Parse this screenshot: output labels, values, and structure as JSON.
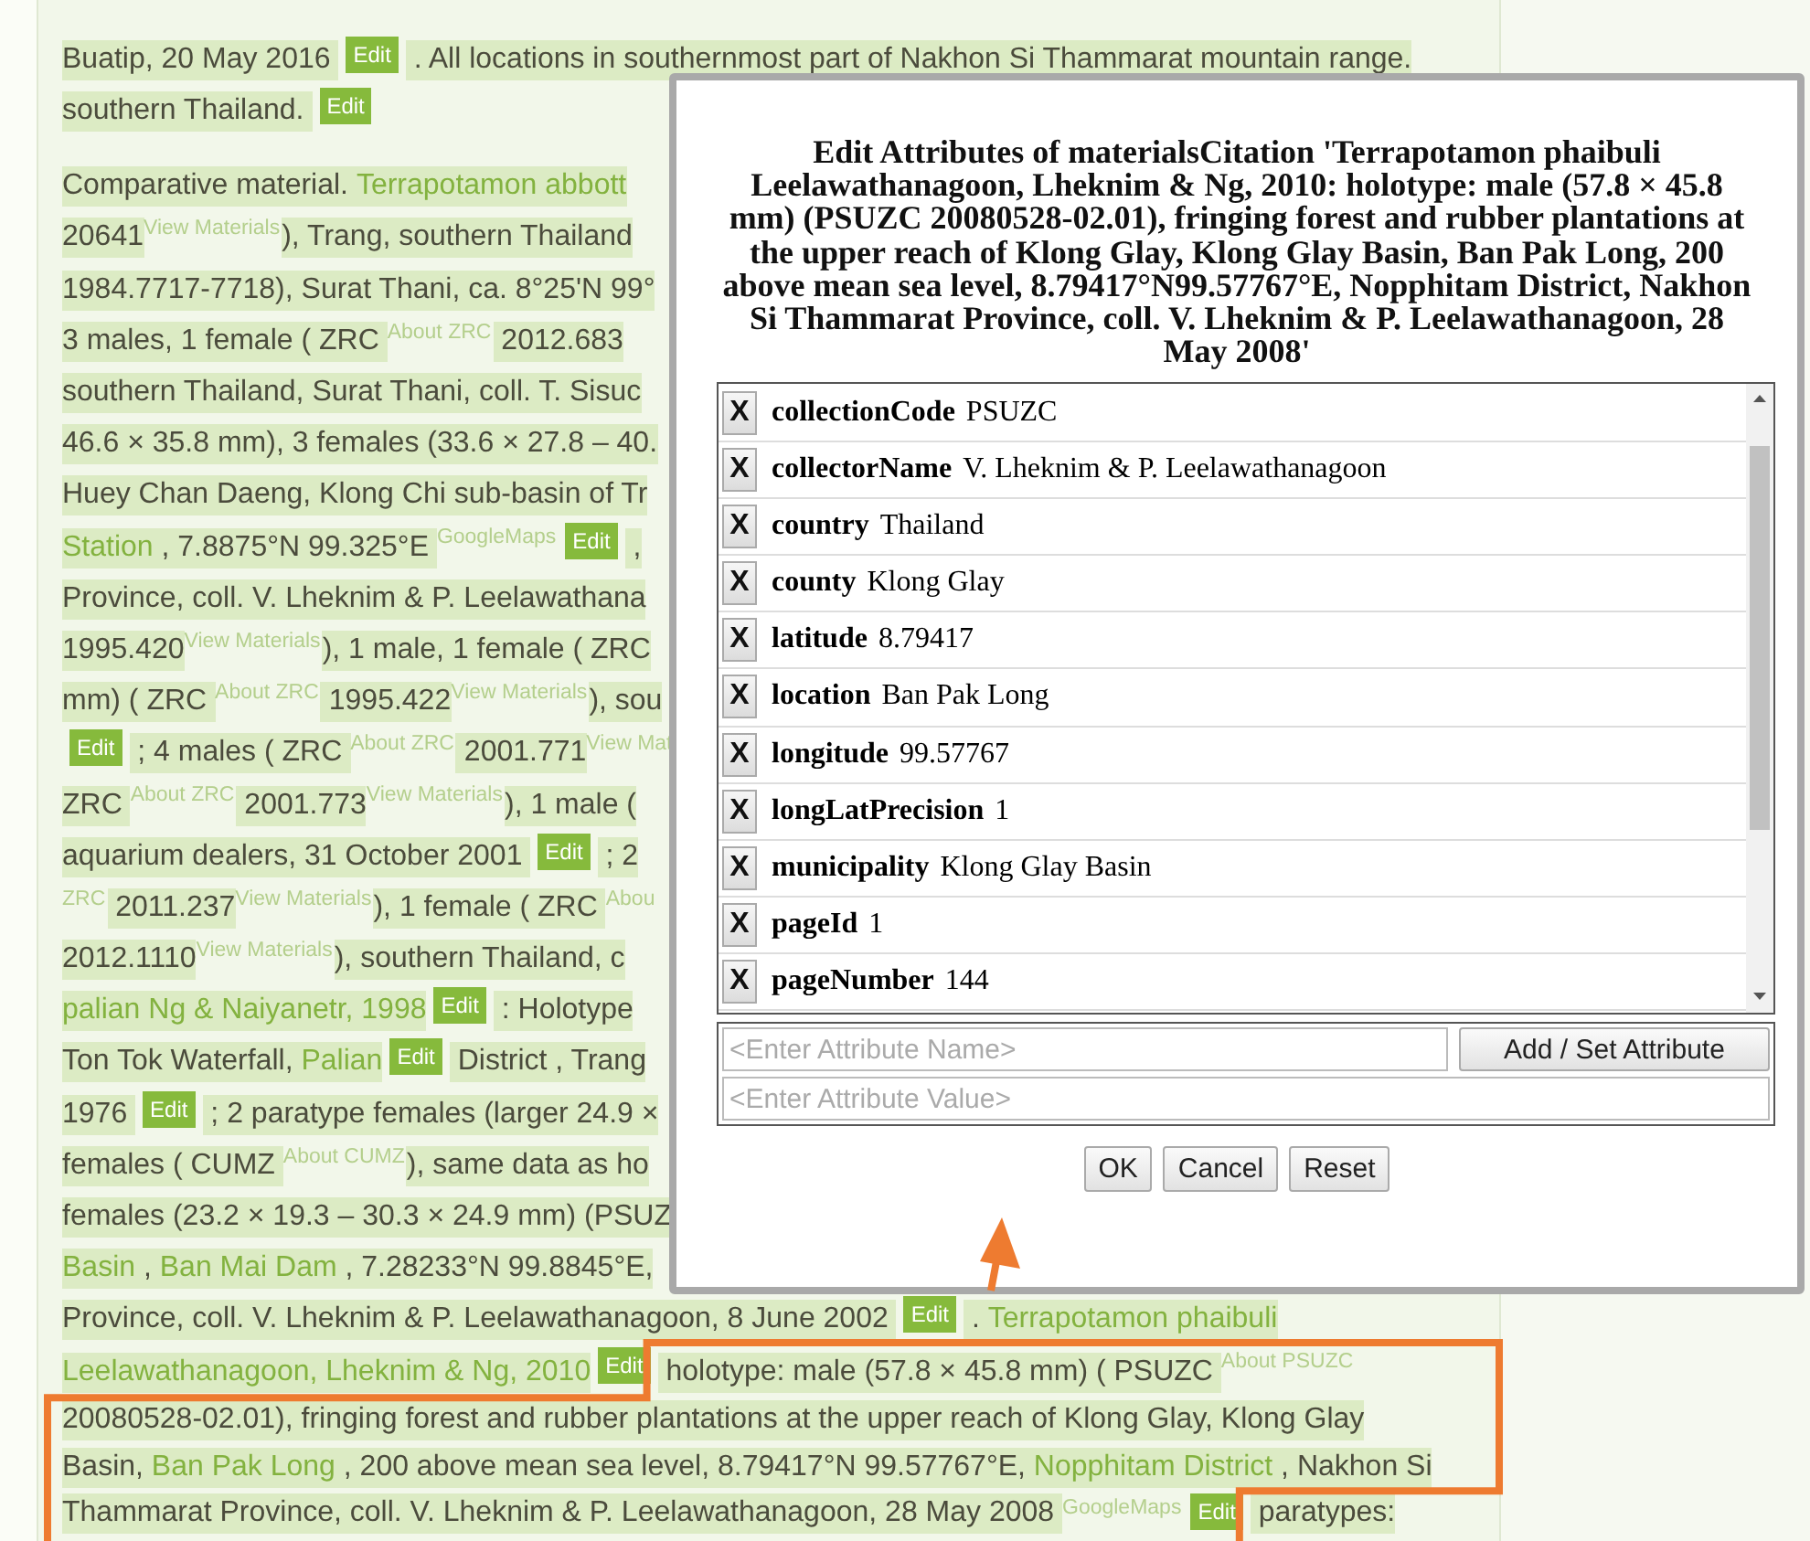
{
  "article": {
    "paragraphs": [
      {
        "lines": [
          {
            "segments": [
              {
                "kind": "text",
                "text": "Buatip, 20 May 2016 "
              },
              {
                "kind": "edit",
                "text": "Edit"
              },
              {
                "kind": "text",
                "text": " . All locations in southernmost part of Nakhon Si Thammarat mountain range."
              }
            ]
          },
          {
            "segments": [
              {
                "kind": "text",
                "text": "southern Thailand. "
              },
              {
                "kind": "edit",
                "text": "Edit"
              }
            ]
          }
        ]
      },
      {
        "lines": [
          {
            "segments": [
              {
                "kind": "text",
                "text": "Comparative material. "
              },
              {
                "kind": "link",
                "text": "Terrapotamon abbott"
              }
            ]
          },
          {
            "segments": [
              {
                "kind": "text",
                "text": "20641"
              },
              {
                "kind": "sup",
                "text": "View Materials"
              },
              {
                "kind": "text",
                "text": "), Trang, southern Thailand"
              }
            ]
          },
          {
            "segments": [
              {
                "kind": "text",
                "text": "1984.7717-7718), Surat Thani, ca. 8°25'N 99°"
              }
            ]
          },
          {
            "segments": [
              {
                "kind": "text",
                "text": "3 males, 1 female ( ZRC "
              },
              {
                "kind": "sup",
                "text": "About ZRC"
              },
              {
                "kind": "text",
                "text": " 2012.683"
              }
            ]
          },
          {
            "segments": [
              {
                "kind": "text",
                "text": "southern Thailand, Surat Thani, coll. T. Sisuc"
              }
            ]
          },
          {
            "segments": [
              {
                "kind": "text",
                "text": "46.6 × 35.8 mm), 3 females (33.6 × 27.8 – 40."
              }
            ]
          },
          {
            "segments": [
              {
                "kind": "text",
                "text": "Huey Chan Daeng, Klong Chi sub-basin of Tr"
              }
            ]
          },
          {
            "segments": [
              {
                "kind": "link",
                "text": "Station"
              },
              {
                "kind": "text",
                "text": " , 7.8875°N 99.325°E "
              },
              {
                "kind": "sup",
                "text": "GoogleMaps"
              },
              {
                "kind": "edit",
                "text": "Edit"
              },
              {
                "kind": "text",
                "text": " ,"
              }
            ]
          },
          {
            "segments": [
              {
                "kind": "text",
                "text": "Province, coll. V. Lheknim & P. Leelawathana"
              }
            ]
          },
          {
            "segments": [
              {
                "kind": "text",
                "text": "1995.420"
              },
              {
                "kind": "sup",
                "text": "View Materials"
              },
              {
                "kind": "text",
                "text": "), 1 male, 1 female ( ZRC"
              }
            ]
          },
          {
            "segments": [
              {
                "kind": "text",
                "text": "mm) ( ZRC "
              },
              {
                "kind": "sup",
                "text": "About ZRC"
              },
              {
                "kind": "text",
                "text": " 1995.422"
              },
              {
                "kind": "sup",
                "text": "View Materials"
              },
              {
                "kind": "text",
                "text": "), sou"
              }
            ]
          },
          {
            "segments": [
              {
                "kind": "edit",
                "text": "Edit"
              },
              {
                "kind": "text",
                "text": " ; 4 males ( ZRC "
              },
              {
                "kind": "sup",
                "text": "About ZRC"
              },
              {
                "kind": "text",
                "text": " 2001.771"
              },
              {
                "kind": "sup",
                "text": "View Mat"
              }
            ]
          },
          {
            "segments": [
              {
                "kind": "text",
                "text": "ZRC "
              },
              {
                "kind": "sup",
                "text": "About ZRC"
              },
              {
                "kind": "text",
                "text": " 2001.773"
              },
              {
                "kind": "sup",
                "text": "View Materials"
              },
              {
                "kind": "text",
                "text": "), 1 male ("
              }
            ]
          },
          {
            "segments": [
              {
                "kind": "text",
                "text": "aquarium dealers, 31 October 2001 "
              },
              {
                "kind": "edit",
                "text": "Edit"
              },
              {
                "kind": "text",
                "text": " ; 2"
              }
            ]
          },
          {
            "segments": [
              {
                "kind": "sup",
                "text": "ZRC"
              },
              {
                "kind": "text",
                "text": " 2011.237"
              },
              {
                "kind": "sup",
                "text": "View Materials"
              },
              {
                "kind": "text",
                "text": "), 1 female ( ZRC "
              },
              {
                "kind": "sup",
                "text": "Abou"
              }
            ]
          },
          {
            "segments": [
              {
                "kind": "text",
                "text": "2012.1110"
              },
              {
                "kind": "sup",
                "text": "View Materials"
              },
              {
                "kind": "text",
                "text": "), southern Thailand, c"
              }
            ]
          },
          {
            "segments": [
              {
                "kind": "link",
                "text": "palian Ng & Naiyanetr, 1998"
              },
              {
                "kind": "edit",
                "text": "Edit"
              },
              {
                "kind": "text",
                "text": " : Holotype"
              }
            ]
          },
          {
            "segments": [
              {
                "kind": "text",
                "text": "Ton Tok Waterfall, "
              },
              {
                "kind": "link",
                "text": "Palian"
              },
              {
                "kind": "edit",
                "text": "Edit"
              },
              {
                "kind": "text",
                "text": " District , Trang"
              }
            ]
          },
          {
            "segments": [
              {
                "kind": "text",
                "text": "1976 "
              },
              {
                "kind": "edit",
                "text": "Edit"
              },
              {
                "kind": "text",
                "text": " ; 2 paratype females (larger 24.9 ×"
              }
            ]
          },
          {
            "segments": [
              {
                "kind": "text",
                "text": "females ( CUMZ "
              },
              {
                "kind": "sup",
                "text": "About CUMZ"
              },
              {
                "kind": "text",
                "text": "), same data as ho"
              }
            ]
          },
          {
            "segments": [
              {
                "kind": "text",
                "text": "females (23.2 × 19.3 – 30.3 × 24.9 mm) (PSUZ"
              }
            ]
          },
          {
            "segments": [
              {
                "kind": "link",
                "text": "Basin"
              },
              {
                "kind": "text",
                "text": " , "
              },
              {
                "kind": "link",
                "text": "Ban Mai Dam"
              },
              {
                "kind": "text",
                "text": " , 7.28233°N 99.8845°E,"
              }
            ]
          },
          {
            "segments": [
              {
                "kind": "text",
                "text": "Province, coll. V. Lheknim & P. Leelawathanagoon, 8 June 2002 "
              },
              {
                "kind": "edit",
                "text": "Edit"
              },
              {
                "kind": "text",
                "text": " . "
              },
              {
                "kind": "link",
                "text": "Terrapotamon phaibuli"
              }
            ]
          },
          {
            "segments": [
              {
                "kind": "link",
                "text": "Leelawathanagoon, Lheknim & Ng, 2010"
              },
              {
                "kind": "edit",
                "text": "Edit"
              },
              {
                "kind": "text",
                "text": " holotype: male (57.8 × 45.8 mm) ( PSUZC "
              },
              {
                "kind": "sup",
                "text": "About PSUZC"
              }
            ]
          },
          {
            "segments": [
              {
                "kind": "text",
                "text": "20080528-02.01), fringing forest and rubber plantations at the upper reach of Klong Glay, Klong Glay"
              }
            ]
          },
          {
            "segments": [
              {
                "kind": "text",
                "text": "Basin, "
              },
              {
                "kind": "link",
                "text": "Ban Pak Long"
              },
              {
                "kind": "text",
                "text": " , 200 above mean sea level, 8.79417°N 99.57767°E, "
              },
              {
                "kind": "link",
                "text": "Nopphitam District"
              },
              {
                "kind": "text",
                "text": " , Nakhon Si"
              }
            ]
          },
          {
            "segments": [
              {
                "kind": "text",
                "text": "Thammarat Province, coll. V. Lheknim & P. Leelawathanagoon, 28 May 2008 "
              },
              {
                "kind": "sup",
                "text": "GoogleMaps"
              },
              {
                "kind": "edit",
                "text": "Edit"
              },
              {
                "kind": "text",
                "text": " paratypes:"
              }
            ]
          }
        ]
      }
    ]
  },
  "dialog": {
    "title": "Edit Attributes of materialsCitation 'Terrapotamon phaibuli Leelawathanagoon, Lheknim & Ng, 2010: holotype: male (57.8 × 45.8 mm) (PSUZC 20080528-02.01), fringing forest and rubber plantations at the upper reach of Klong Glay, Klong Glay Basin, Ban Pak Long, 200 above mean sea level, 8.79417°N99.57767°E, Nopphitam District, Nakhon Si Thammarat Province, coll. V. Lheknim & P. Leelawathanagoon, 28 May 2008'",
    "attributes": [
      {
        "remove": "X",
        "name": "collectionCode",
        "value": "PSUZC"
      },
      {
        "remove": "X",
        "name": "collectorName",
        "value": "V. Lheknim & P. Leelawathanagoon"
      },
      {
        "remove": "X",
        "name": "country",
        "value": "Thailand"
      },
      {
        "remove": "X",
        "name": "county",
        "value": "Klong Glay"
      },
      {
        "remove": "X",
        "name": "latitude",
        "value": "8.79417"
      },
      {
        "remove": "X",
        "name": "location",
        "value": "Ban Pak Long"
      },
      {
        "remove": "X",
        "name": "longitude",
        "value": "99.57767"
      },
      {
        "remove": "X",
        "name": "longLatPrecision",
        "value": "1"
      },
      {
        "remove": "X",
        "name": "municipality",
        "value": "Klong Glay Basin"
      },
      {
        "remove": "X",
        "name": "pageId",
        "value": "1"
      },
      {
        "remove": "X",
        "name": "pageNumber",
        "value": "144"
      }
    ],
    "name_field": {
      "placeholder": "<Enter Attribute Name>"
    },
    "add_button": "Add / Set Attribute",
    "value_field": {
      "placeholder": "<Enter Attribute Value>"
    },
    "buttons": [
      "OK",
      "Cancel",
      "Reset"
    ]
  }
}
